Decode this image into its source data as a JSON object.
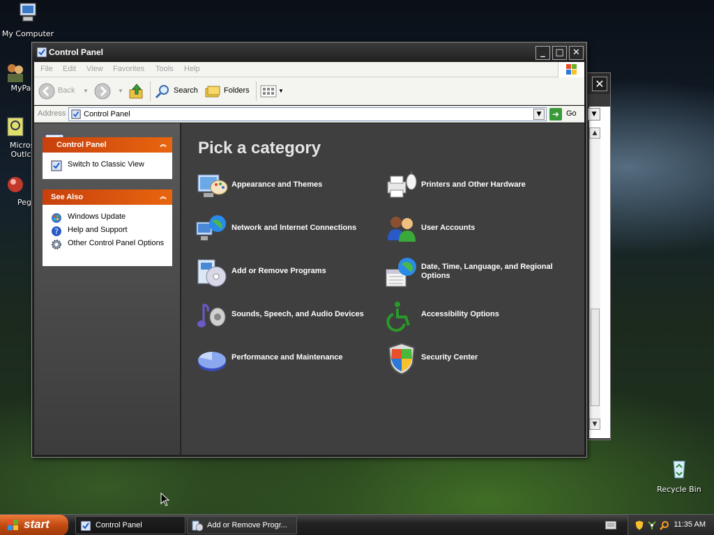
{
  "desktop": {
    "icons": [
      {
        "label": "My Computer"
      },
      {
        "label": "MyPa"
      },
      {
        "label": "Micros Outlc"
      },
      {
        "label": "Peg"
      },
      {
        "label": "Recycle Bin"
      }
    ]
  },
  "window": {
    "title": "Control Panel",
    "menu": [
      "File",
      "Edit",
      "View",
      "Favorites",
      "Tools",
      "Help"
    ],
    "toolbar": {
      "back": "Back",
      "search": "Search",
      "folders": "Folders"
    },
    "address": {
      "label": "Address",
      "value": "Control Panel",
      "go": "Go"
    }
  },
  "sidebar": {
    "panel_title": "Control Panel",
    "panel_links": [
      "Switch to Classic View"
    ],
    "see_also_title": "See Also",
    "see_also_links": [
      "Windows Update",
      "Help and Support",
      "Other Control Panel Options"
    ]
  },
  "main": {
    "heading": "Pick a category",
    "categories": [
      {
        "label": "Appearance and Themes",
        "icon": "appearance-icon"
      },
      {
        "label": "Printers and Other Hardware",
        "icon": "printer-icon"
      },
      {
        "label": "Network and Internet Connections",
        "icon": "network-icon"
      },
      {
        "label": "User Accounts",
        "icon": "users-icon"
      },
      {
        "label": "Add or Remove Programs",
        "icon": "add-remove-icon"
      },
      {
        "label": "Date, Time, Language, and Regional Options",
        "icon": "date-time-icon"
      },
      {
        "label": "Sounds, Speech, and Audio Devices",
        "icon": "sound-icon"
      },
      {
        "label": "Accessibility Options",
        "icon": "accessibility-icon"
      },
      {
        "label": "Performance and Maintenance",
        "icon": "performance-icon"
      },
      {
        "label": "Security Center",
        "icon": "security-shield-icon"
      }
    ]
  },
  "taskbar": {
    "start": "start",
    "tasks": [
      "Control Panel",
      "Add or Remove Progr..."
    ],
    "clock": "11:35 AM"
  },
  "colors": {
    "header_orange": "#e8650f",
    "content_bg": "#3f3f3f",
    "sidebar_bg": "#4a4a4a"
  }
}
